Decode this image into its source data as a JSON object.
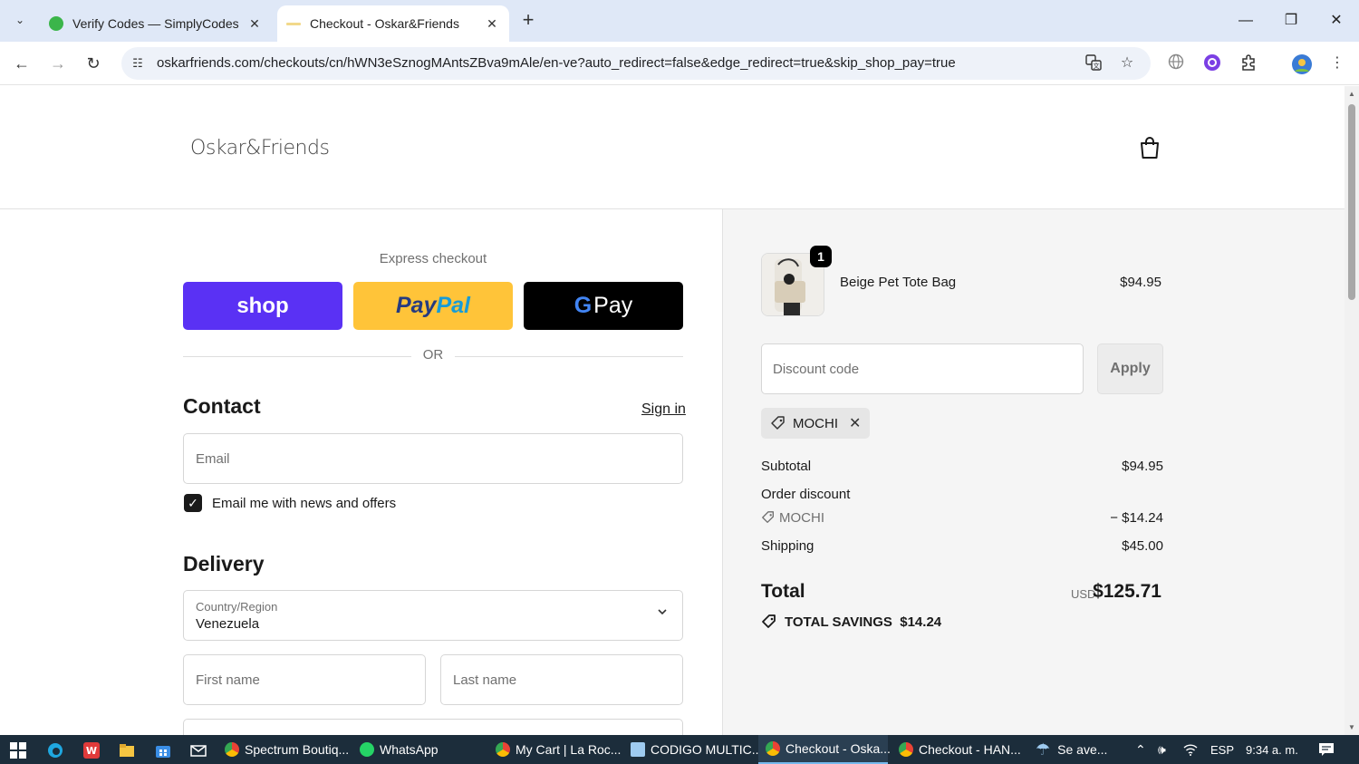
{
  "browser": {
    "tabs": [
      {
        "title": "Verify Codes — SimplyCodes",
        "active": false
      },
      {
        "title": "Checkout - Oskar&Friends",
        "active": true
      }
    ],
    "url": "oskarfriends.com/checkouts/cn/hWN3eSznogMAntsZBva9mAle/en-ve?auto_redirect=false&edge_redirect=true&skip_shop_pay=true"
  },
  "header": {
    "logo": "Oskar&Friends"
  },
  "checkout": {
    "express_label": "Express checkout",
    "shop_label": "shop",
    "paypal_pay": "Pay",
    "paypal_pal": "Pal",
    "gpay_g": "G",
    "gpay_label": "Pay",
    "or_label": "OR",
    "contact_title": "Contact",
    "sign_in": "Sign in",
    "email_placeholder": "Email",
    "news_checkbox_label": "Email me with news and offers",
    "news_checked": true,
    "delivery_title": "Delivery",
    "country_label": "Country/Region",
    "country_value": "Venezuela",
    "first_name_placeholder": "First name",
    "last_name_placeholder": "Last name"
  },
  "summary": {
    "item": {
      "name": "Beige Pet Tote Bag",
      "price": "$94.95",
      "quantity": "1"
    },
    "discount_placeholder": "Discount code",
    "apply_label": "Apply",
    "applied_code": "MOCHI",
    "subtotal_label": "Subtotal",
    "subtotal_value": "$94.95",
    "order_discount_label": "Order discount",
    "order_discount_code": "MOCHI",
    "order_discount_value": "− $14.24",
    "shipping_label": "Shipping",
    "shipping_value": "$45.00",
    "total_label": "Total",
    "total_currency": "USD",
    "total_value": "$125.71",
    "savings_label": "TOTAL SAVINGS",
    "savings_value": "$14.24"
  },
  "taskbar": {
    "items": [
      {
        "label": "Spectrum Boutiq..."
      },
      {
        "label": "WhatsApp"
      },
      {
        "label": "My Cart | La Roc..."
      },
      {
        "label": "CODIGO MULTIC..."
      },
      {
        "label": "Checkout - Oska..."
      },
      {
        "label": "Checkout - HAN..."
      },
      {
        "label": "Se ave..."
      }
    ],
    "language": "ESP",
    "clock": "9:34 a. m."
  },
  "colors": {
    "shop_pay": "#5a31f4",
    "paypal": "#ffc439",
    "gpay": "#000000",
    "summary_bg": "#f5f5f5"
  }
}
